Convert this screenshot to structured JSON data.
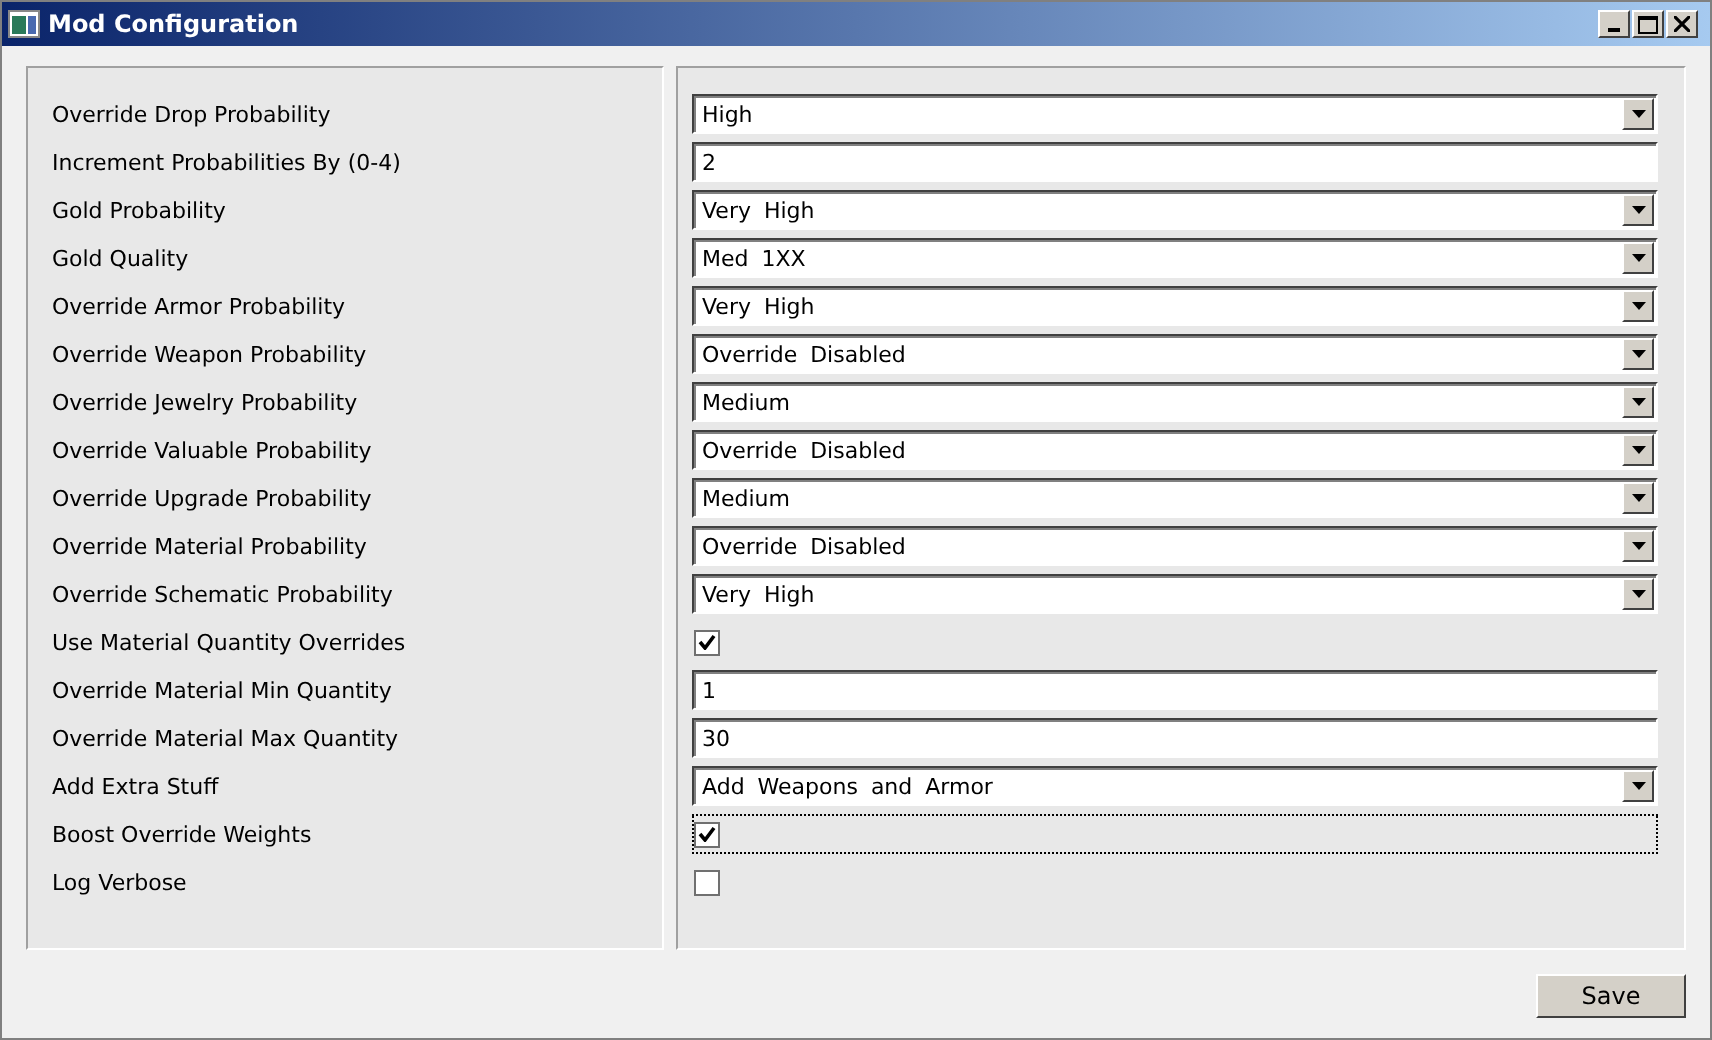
{
  "window": {
    "title": "Mod Configuration"
  },
  "settings": [
    {
      "label": "Override Drop Probability",
      "kind": "dropdown",
      "value": "High"
    },
    {
      "label": "Increment Probabilities By (0-4)",
      "kind": "text",
      "value": "2"
    },
    {
      "label": "Gold Probability",
      "kind": "dropdown",
      "value": "Very High"
    },
    {
      "label": "Gold Quality",
      "kind": "dropdown",
      "value": "Med 1XX"
    },
    {
      "label": "Override Armor Probability",
      "kind": "dropdown",
      "value": "Very High"
    },
    {
      "label": "Override Weapon Probability",
      "kind": "dropdown",
      "value": "Override Disabled"
    },
    {
      "label": "Override Jewelry Probability",
      "kind": "dropdown",
      "value": "Medium"
    },
    {
      "label": "Override Valuable Probability",
      "kind": "dropdown",
      "value": "Override Disabled"
    },
    {
      "label": "Override Upgrade Probability",
      "kind": "dropdown",
      "value": "Medium"
    },
    {
      "label": "Override Material Probability",
      "kind": "dropdown",
      "value": "Override Disabled"
    },
    {
      "label": "Override Schematic Probability",
      "kind": "dropdown",
      "value": "Very High"
    },
    {
      "label": "Use Material Quantity Overrides",
      "kind": "checkbox",
      "checked": true,
      "focused": false
    },
    {
      "label": "Override Material Min Quantity",
      "kind": "text",
      "value": "1"
    },
    {
      "label": "Override Material Max Quantity",
      "kind": "text",
      "value": "30"
    },
    {
      "label": "Add Extra Stuff",
      "kind": "dropdown",
      "value": "Add Weapons and Armor"
    },
    {
      "label": "Boost Override Weights",
      "kind": "checkbox",
      "checked": true,
      "focused": true
    },
    {
      "label": "Log Verbose",
      "kind": "checkbox",
      "checked": false,
      "focused": false
    }
  ],
  "buttons": [
    "Save"
  ]
}
